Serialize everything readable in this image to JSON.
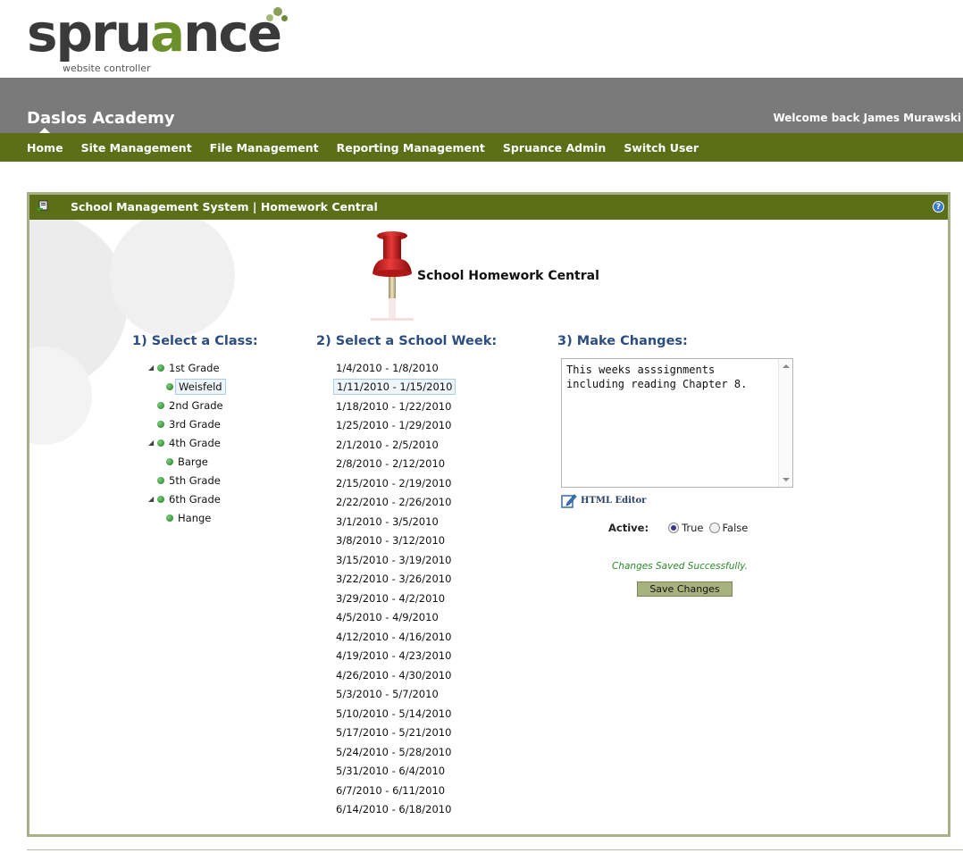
{
  "logo": {
    "text_main": "spru",
    "text_accent": "a",
    "text_end": "nce",
    "tagline": "website controller"
  },
  "site": {
    "title": "Daslos Academy",
    "welcome": "Welcome back James Murawski"
  },
  "nav": {
    "items": [
      "Home",
      "Site Management",
      "File Management",
      "Reporting Management",
      "Spruance Admin",
      "Switch User"
    ]
  },
  "panel": {
    "title": "School Management System | Homework Central",
    "help_glyph": "?"
  },
  "homework": {
    "title": "School Homework Central"
  },
  "sections": {
    "class": "1) Select a Class:",
    "week": "2) Select a School Week:",
    "changes": "3) Make Changes:"
  },
  "classes": [
    {
      "label": "1st Grade",
      "level": 0,
      "expanded": true
    },
    {
      "label": "Weisfeld",
      "level": 1,
      "selected": true
    },
    {
      "label": "2nd Grade",
      "level": 0
    },
    {
      "label": "3rd Grade",
      "level": 0
    },
    {
      "label": "4th Grade",
      "level": 0,
      "expanded": true
    },
    {
      "label": "Barge",
      "level": 1
    },
    {
      "label": "5th Grade",
      "level": 0
    },
    {
      "label": "6th Grade",
      "level": 0,
      "expanded": true
    },
    {
      "label": "Hange",
      "level": 1
    }
  ],
  "weeks": [
    "1/4/2010 - 1/8/2010",
    "1/11/2010 - 1/15/2010",
    "1/18/2010 - 1/22/2010",
    "1/25/2010 - 1/29/2010",
    "2/1/2010 - 2/5/2010",
    "2/8/2010 - 2/12/2010",
    "2/15/2010 - 2/19/2010",
    "2/22/2010 - 2/26/2010",
    "3/1/2010 - 3/5/2010",
    "3/8/2010 - 3/12/2010",
    "3/15/2010 - 3/19/2010",
    "3/22/2010 - 3/26/2010",
    "3/29/2010 - 4/2/2010",
    "4/5/2010 - 4/9/2010",
    "4/12/2010 - 4/16/2010",
    "4/19/2010 - 4/23/2010",
    "4/26/2010 - 4/30/2010",
    "5/3/2010 - 5/7/2010",
    "5/10/2010 - 5/14/2010",
    "5/17/2010 - 5/21/2010",
    "5/24/2010 - 5/28/2010",
    "5/31/2010 - 6/4/2010",
    "6/7/2010 - 6/11/2010",
    "6/14/2010 - 6/18/2010"
  ],
  "selected_week_index": 1,
  "editor": {
    "content": "This weeks asssignments\nincluding reading Chapter 8.",
    "html_editor_label": "HTML Editor"
  },
  "active": {
    "label": "Active:",
    "true_label": "True",
    "false_label": "False",
    "value": "True"
  },
  "status": {
    "message": "Changes Saved Successfully."
  },
  "buttons": {
    "save": "Save Changes"
  },
  "colors": {
    "nav_green": "#5c6e18",
    "header_gray": "#7a7a7a",
    "section_blue": "#2b4d80",
    "success_green": "#2a8a2a",
    "button_olive": "#a8b27e"
  }
}
